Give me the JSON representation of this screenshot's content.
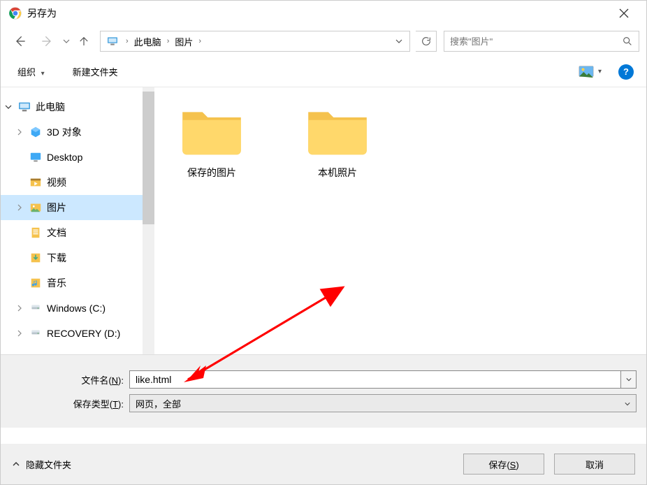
{
  "title": "另存为",
  "breadcrumbs": {
    "root": "此电脑",
    "folder": "图片"
  },
  "search": {
    "placeholder": "搜索\"图片\""
  },
  "toolbar": {
    "organize": "组织",
    "new_folder": "新建文件夹"
  },
  "tree": {
    "root": "此电脑",
    "items": [
      {
        "label": "3D 对象"
      },
      {
        "label": "Desktop"
      },
      {
        "label": "视频"
      },
      {
        "label": "图片",
        "selected": true
      },
      {
        "label": "文档"
      },
      {
        "label": "下载"
      },
      {
        "label": "音乐"
      },
      {
        "label": "Windows (C:)"
      },
      {
        "label": "RECOVERY (D:)"
      }
    ]
  },
  "folders": [
    {
      "name": "保存的图片"
    },
    {
      "name": "本机照片"
    }
  ],
  "fields": {
    "filename_label_pre": "文件名(",
    "filename_label_u": "N",
    "filename_label_post": "):",
    "filename_value": "like.html",
    "filetype_label_pre": "保存类型(",
    "filetype_label_u": "T",
    "filetype_label_post": "):",
    "filetype_value": "网页，全部"
  },
  "footer": {
    "hide": "隐藏文件夹",
    "save_pre": "保存(",
    "save_u": "S",
    "save_post": ")",
    "cancel": "取消"
  }
}
